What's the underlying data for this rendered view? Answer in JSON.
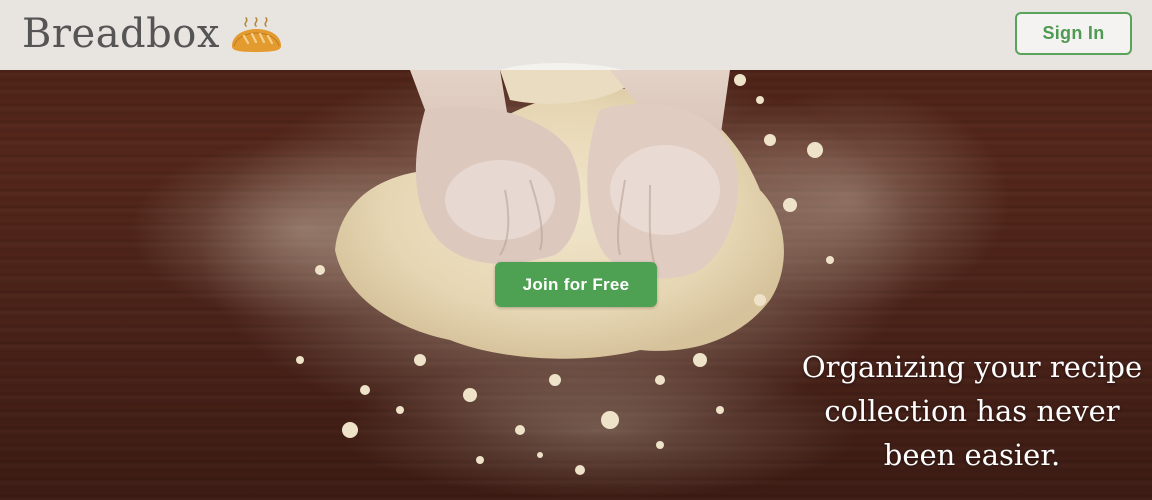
{
  "header": {
    "brand_name": "Breadbox",
    "brand_icon": "bread-loaf-icon",
    "sign_in_label": "Sign In"
  },
  "hero": {
    "image": "hands-kneading-dough-photo",
    "cta_label": "Join for Free",
    "tagline": "Organizing your recipe\ncollection has never\nbeen easier."
  },
  "colors": {
    "accent_green": "#4ea153",
    "header_bg": "#f4f3f0",
    "wood": "#4a2117"
  }
}
